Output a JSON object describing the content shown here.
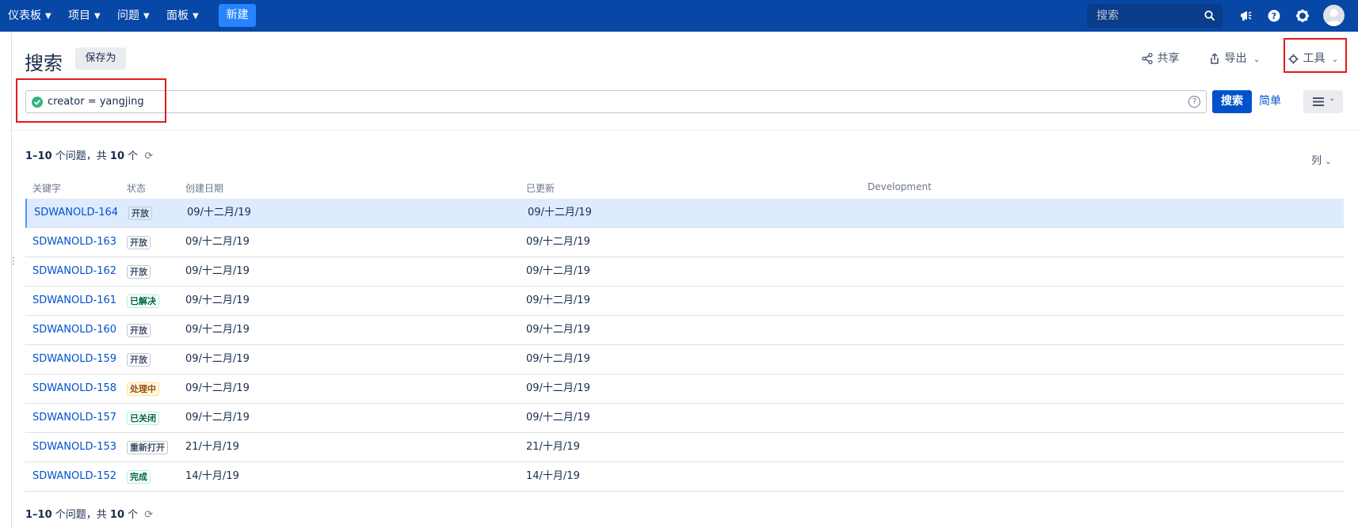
{
  "topnav": {
    "items": [
      {
        "label": "仪表板"
      },
      {
        "label": "项目"
      },
      {
        "label": "问题"
      },
      {
        "label": "面板"
      }
    ],
    "create_label": "新建",
    "search_placeholder": "搜索",
    "icons": [
      "megaphone-icon",
      "help-icon",
      "settings-icon",
      "avatar"
    ]
  },
  "header": {
    "title": "搜索",
    "save_as_label": "保存为",
    "share_label": "共享",
    "export_label": "导出",
    "tools_label": "工具"
  },
  "query": {
    "value": "creator = yangjing",
    "search_button": "搜索",
    "simple_link": "简单"
  },
  "results": {
    "count_text_top": {
      "range": "1–10",
      "mid": " 个问题，共 ",
      "total": "10",
      "suffix": " 个"
    },
    "count_text_bottom": {
      "range": "1–10",
      "mid": " 个问题，共 ",
      "total": "10",
      "suffix": " 个"
    },
    "columns_label": "列",
    "columns": [
      "关键字",
      "状态",
      "创建日期",
      "已更新",
      "Development"
    ],
    "rows": [
      {
        "key": "SDWANOLD-164",
        "status": "开放",
        "status_color": "blue",
        "created": "09/十二月/19",
        "updated": "09/十二月/19",
        "selected": true
      },
      {
        "key": "SDWANOLD-163",
        "status": "开放",
        "status_color": "blue",
        "created": "09/十二月/19",
        "updated": "09/十二月/19"
      },
      {
        "key": "SDWANOLD-162",
        "status": "开放",
        "status_color": "blue",
        "created": "09/十二月/19",
        "updated": "09/十二月/19"
      },
      {
        "key": "SDWANOLD-161",
        "status": "已解决",
        "status_color": "green",
        "created": "09/十二月/19",
        "updated": "09/十二月/19"
      },
      {
        "key": "SDWANOLD-160",
        "status": "开放",
        "status_color": "blue",
        "created": "09/十二月/19",
        "updated": "09/十二月/19"
      },
      {
        "key": "SDWANOLD-159",
        "status": "开放",
        "status_color": "blue",
        "created": "09/十二月/19",
        "updated": "09/十二月/19"
      },
      {
        "key": "SDWANOLD-158",
        "status": "处理中",
        "status_color": "yellow",
        "created": "09/十二月/19",
        "updated": "09/十二月/19"
      },
      {
        "key": "SDWANOLD-157",
        "status": "已关闭",
        "status_color": "green",
        "created": "09/十二月/19",
        "updated": "09/十二月/19"
      },
      {
        "key": "SDWANOLD-153",
        "status": "重新打开",
        "status_color": "blue",
        "created": "21/十月/19",
        "updated": "21/十月/19"
      },
      {
        "key": "SDWANOLD-152",
        "status": "完成",
        "status_color": "green",
        "created": "14/十月/19",
        "updated": "14/十月/19"
      }
    ]
  }
}
